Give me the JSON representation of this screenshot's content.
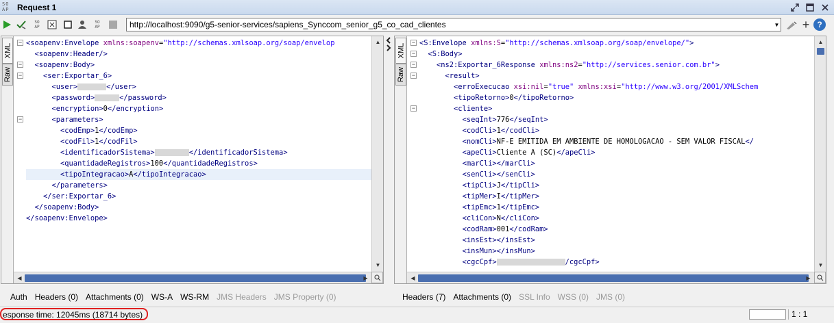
{
  "window": {
    "title": "Request 1",
    "logo_text": "SO AP"
  },
  "toolbar": {
    "url": "http://localhost:9090/g5-senior-services/sapiens_Synccom_senior_g5_co_cad_clientes",
    "zoom_plus": "+",
    "help": "?"
  },
  "left_panel": {
    "tab_xml": "XML",
    "tab_raw": "Raw",
    "lines": [
      {
        "indent": 0,
        "html": "<span class='tg'>&lt;soapenv:Envelope</span> <span class='at'>xmlns:soapenv</span>=<span class='av'>\"http://schemas.xmlsoap.org/soap/envelop</span>"
      },
      {
        "indent": 2,
        "html": "<span class='tg'>&lt;soapenv:Header/&gt;</span>"
      },
      {
        "indent": 2,
        "html": "<span class='tg'>&lt;soapenv:Body&gt;</span>"
      },
      {
        "indent": 4,
        "html": "<span class='tg'>&lt;ser:Exportar_6&gt;</span>"
      },
      {
        "indent": 6,
        "html": "<span class='tg'>&lt;user&gt;</span><span class='blur' style='width:42px'></span><span class='tg'>&lt;/user&gt;</span>"
      },
      {
        "indent": 6,
        "html": "<span class='tg'>&lt;password&gt;</span><span class='blur' style='width:36px'></span><span class='tg'>&lt;/password&gt;</span>"
      },
      {
        "indent": 6,
        "html": "<span class='tg'>&lt;encryption&gt;</span><span class='tx'>0</span><span class='tg'>&lt;/encryption&gt;</span>"
      },
      {
        "indent": 6,
        "html": "<span class='tg'>&lt;parameters&gt;</span>"
      },
      {
        "indent": 8,
        "html": "<span class='tg'>&lt;codEmp&gt;</span><span class='tx'>1</span><span class='tg'>&lt;/codEmp&gt;</span>"
      },
      {
        "indent": 8,
        "html": "<span class='tg'>&lt;codFil&gt;</span><span class='tx'>1</span><span class='tg'>&lt;/codFil&gt;</span>"
      },
      {
        "indent": 8,
        "html": "<span class='tg'>&lt;identificadorSistema&gt;</span><span class='blur' style='width:50px'></span><span class='tg'>&lt;/identificadorSistema&gt;</span>"
      },
      {
        "indent": 8,
        "html": "<span class='tg'>&lt;quantidadeRegistros&gt;</span><span class='tx'>100</span><span class='tg'>&lt;/quantidadeRegistros&gt;</span>"
      },
      {
        "indent": 8,
        "html": "<span class='tg'>&lt;tipoIntegracao&gt;</span><span class='tx'>A</span><span class='tg'>&lt;/tipoIntegracao&gt;</span>",
        "highlight": true
      },
      {
        "indent": 6,
        "html": "<span class='tg'>&lt;/parameters&gt;</span>"
      },
      {
        "indent": 4,
        "html": "<span class='tg'>&lt;/ser:Exportar_6&gt;</span>"
      },
      {
        "indent": 2,
        "html": "<span class='tg'>&lt;/soapenv:Body&gt;</span>"
      },
      {
        "indent": 0,
        "html": "<span class='tg'>&lt;/soapenv:Envelope&gt;</span>"
      }
    ],
    "tabs": [
      {
        "label": "Auth",
        "disabled": false
      },
      {
        "label": "Headers (0)",
        "disabled": false
      },
      {
        "label": "Attachments (0)",
        "disabled": false
      },
      {
        "label": "WS-A",
        "disabled": false
      },
      {
        "label": "WS-RM",
        "disabled": false
      },
      {
        "label": "JMS Headers",
        "disabled": true
      },
      {
        "label": "JMS Property (0)",
        "disabled": true
      }
    ]
  },
  "right_panel": {
    "tab_xml": "XML",
    "tab_raw": "Raw",
    "lines": [
      {
        "indent": 0,
        "html": "<span class='tg'>&lt;S:Envelope</span> <span class='at'>xmlns:S</span>=<span class='av'>\"http://schemas.xmlsoap.org/soap/envelope/\"</span><span class='tg'>&gt;</span>"
      },
      {
        "indent": 2,
        "html": "<span class='tg'>&lt;S:Body&gt;</span>"
      },
      {
        "indent": 4,
        "html": "<span class='tg'>&lt;ns2:Exportar_6Response</span> <span class='at'>xmlns:ns2</span>=<span class='av'>\"http://services.senior.com.br\"</span><span class='tg'>&gt;</span>"
      },
      {
        "indent": 6,
        "html": "<span class='tg'>&lt;result&gt;</span>"
      },
      {
        "indent": 8,
        "html": "<span class='tg'>&lt;erroExecucao</span> <span class='at'>xsi:nil</span>=<span class='av'>\"true\"</span> <span class='at'>xmlns:xsi</span>=<span class='av'>\"http://www.w3.org/2001/XMLSchem</span>"
      },
      {
        "indent": 8,
        "html": "<span class='tg'>&lt;tipoRetorno&gt;</span><span class='tx'>0</span><span class='tg'>&lt;/tipoRetorno&gt;</span>"
      },
      {
        "indent": 8,
        "html": "<span class='tg'>&lt;cliente&gt;</span>"
      },
      {
        "indent": 10,
        "html": "<span class='tg'>&lt;seqInt&gt;</span><span class='tx'>776</span><span class='tg'>&lt;/seqInt&gt;</span>"
      },
      {
        "indent": 10,
        "html": "<span class='tg'>&lt;codCli&gt;</span><span class='tx'>1</span><span class='tg'>&lt;/codCli&gt;</span>"
      },
      {
        "indent": 10,
        "html": "<span class='tg'>&lt;nomCli&gt;</span><span class='tx'>NF-E EMITIDA EM AMBIENTE DE HOMOLOGACAO - SEM VALOR FISCAL</span><span class='tg'>&lt;/</span>"
      },
      {
        "indent": 10,
        "html": "<span class='tg'>&lt;apeCli&gt;</span><span class='tx'>Cliente A (SC)</span><span class='tg'>&lt;/apeCli&gt;</span>"
      },
      {
        "indent": 10,
        "html": "<span class='tg'>&lt;marCli&gt;&lt;/marCli&gt;</span>"
      },
      {
        "indent": 10,
        "html": "<span class='tg'>&lt;senCli&gt;&lt;/senCli&gt;</span>"
      },
      {
        "indent": 10,
        "html": "<span class='tg'>&lt;tipCli&gt;</span><span class='tx'>J</span><span class='tg'>&lt;/tipCli&gt;</span>"
      },
      {
        "indent": 10,
        "html": "<span class='tg'>&lt;tipMer&gt;</span><span class='tx'>I</span><span class='tg'>&lt;/tipMer&gt;</span>"
      },
      {
        "indent": 10,
        "html": "<span class='tg'>&lt;tipEmc&gt;</span><span class='tx'>1</span><span class='tg'>&lt;/tipEmc&gt;</span>"
      },
      {
        "indent": 10,
        "html": "<span class='tg'>&lt;cliCon&gt;</span><span class='tx'>N</span><span class='tg'>&lt;/cliCon&gt;</span>"
      },
      {
        "indent": 10,
        "html": "<span class='tg'>&lt;codRam&gt;</span><span class='tx'>001</span><span class='tg'>&lt;/codRam&gt;</span>"
      },
      {
        "indent": 10,
        "html": "<span class='tg'>&lt;insEst&gt;&lt;/insEst&gt;</span>"
      },
      {
        "indent": 10,
        "html": "<span class='tg'>&lt;insMun&gt;&lt;/insMun&gt;</span>"
      },
      {
        "indent": 10,
        "html": "<span class='tg'>&lt;cgcCpf&gt;</span><span class='blur' style='width:100px'></span><span class='tg'>/cgcCpf&gt;</span>"
      }
    ],
    "tabs": [
      {
        "label": "Headers (7)",
        "disabled": false
      },
      {
        "label": "Attachments (0)",
        "disabled": false
      },
      {
        "label": "SSL Info",
        "disabled": true
      },
      {
        "label": "WSS (0)",
        "disabled": true
      },
      {
        "label": "JMS (0)",
        "disabled": true
      }
    ]
  },
  "status": {
    "response_time": "esponse time: 12045ms (18714 bytes)",
    "cursor": "1 : 1"
  }
}
